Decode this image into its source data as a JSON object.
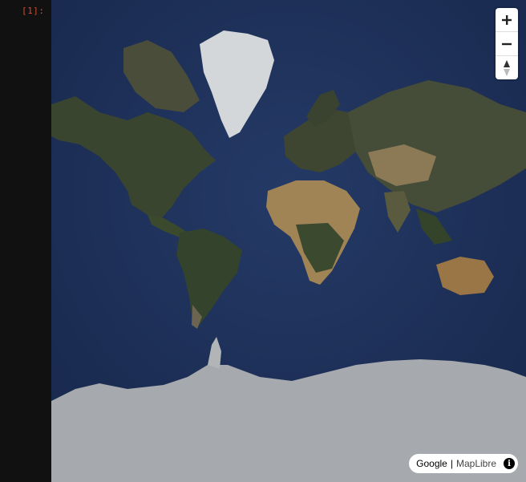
{
  "notebook": {
    "prompt": "[1]:"
  },
  "map": {
    "style": "satellite",
    "controls": {
      "zoom_in_icon": "plus-icon",
      "zoom_out_icon": "minus-icon",
      "compass_icon": "compass-icon"
    },
    "attribution": {
      "provider": "Google",
      "separator": "|",
      "library": "MapLibre",
      "info_icon": "info-icon",
      "info_glyph": "i"
    },
    "colors": {
      "ocean": "#1f2f55",
      "land_dark": "#2f3a2a",
      "desert": "#a3865a",
      "ice": "#a9acaf"
    }
  }
}
